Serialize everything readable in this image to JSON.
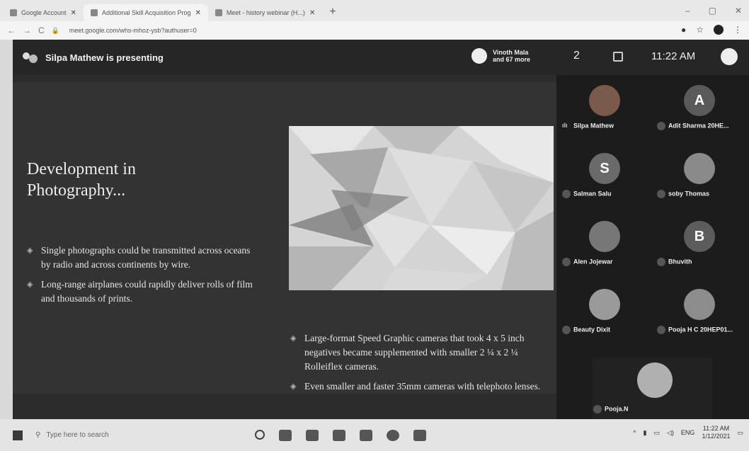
{
  "browser": {
    "tabs": [
      {
        "label": "Google Account",
        "active": false
      },
      {
        "label": "Additional Skill Acquisition Prog",
        "active": true
      },
      {
        "label": "Meet - history webinar (H...)",
        "active": false
      }
    ],
    "new_tab": "+",
    "url": "meet.google.com/whs-mhoz-ysb?authuser=0"
  },
  "meet": {
    "presenting_text": "Silpa Mathew is presenting",
    "people_line1": "Vinoth Mala",
    "people_line2": "and 67 more",
    "participant_count": "2",
    "clock": "11:22 AM"
  },
  "slide": {
    "title": "Development in Photography...",
    "left_bullets": [
      "Single photographs could be transmitted across oceans by radio and across continents by wire.",
      "Long-range airplanes could rapidly deliver rolls of film and thousands of prints."
    ],
    "right_bullets": [
      "Large-format Speed Graphic cameras that took 4 x 5 inch negatives became supplemented with smaller 2 ¼ x 2 ¼ Rolleiflex cameras.",
      "Even smaller and faster 35mm cameras with telephoto lenses."
    ]
  },
  "participants": [
    {
      "name": "Silpa Mathew",
      "initial": "",
      "color": "#7a5a4a"
    },
    {
      "name": "Adit Sharma 20HE...",
      "initial": "A",
      "color": "#5a5a5a"
    },
    {
      "name": "Salman Salu",
      "initial": "S",
      "color": "#6a6a6a"
    },
    {
      "name": "soby Thomas",
      "initial": "",
      "color": "#8a8a8a"
    },
    {
      "name": "Alen Jojewar",
      "initial": "",
      "color": "#777"
    },
    {
      "name": "Bhuvith",
      "initial": "B",
      "color": "#5c5c5c"
    },
    {
      "name": "Beauty Dixit",
      "initial": "",
      "color": "#9a9a9a"
    },
    {
      "name": "Pooja H C 20HEP01...",
      "initial": "",
      "color": "#8c8c8c"
    },
    {
      "name": "Pooja.N",
      "initial": "",
      "color": "#b0b0b0"
    }
  ],
  "taskbar": {
    "search_placeholder": "Type here to search",
    "time": "11:22 AM",
    "date": "1/12/2021"
  }
}
